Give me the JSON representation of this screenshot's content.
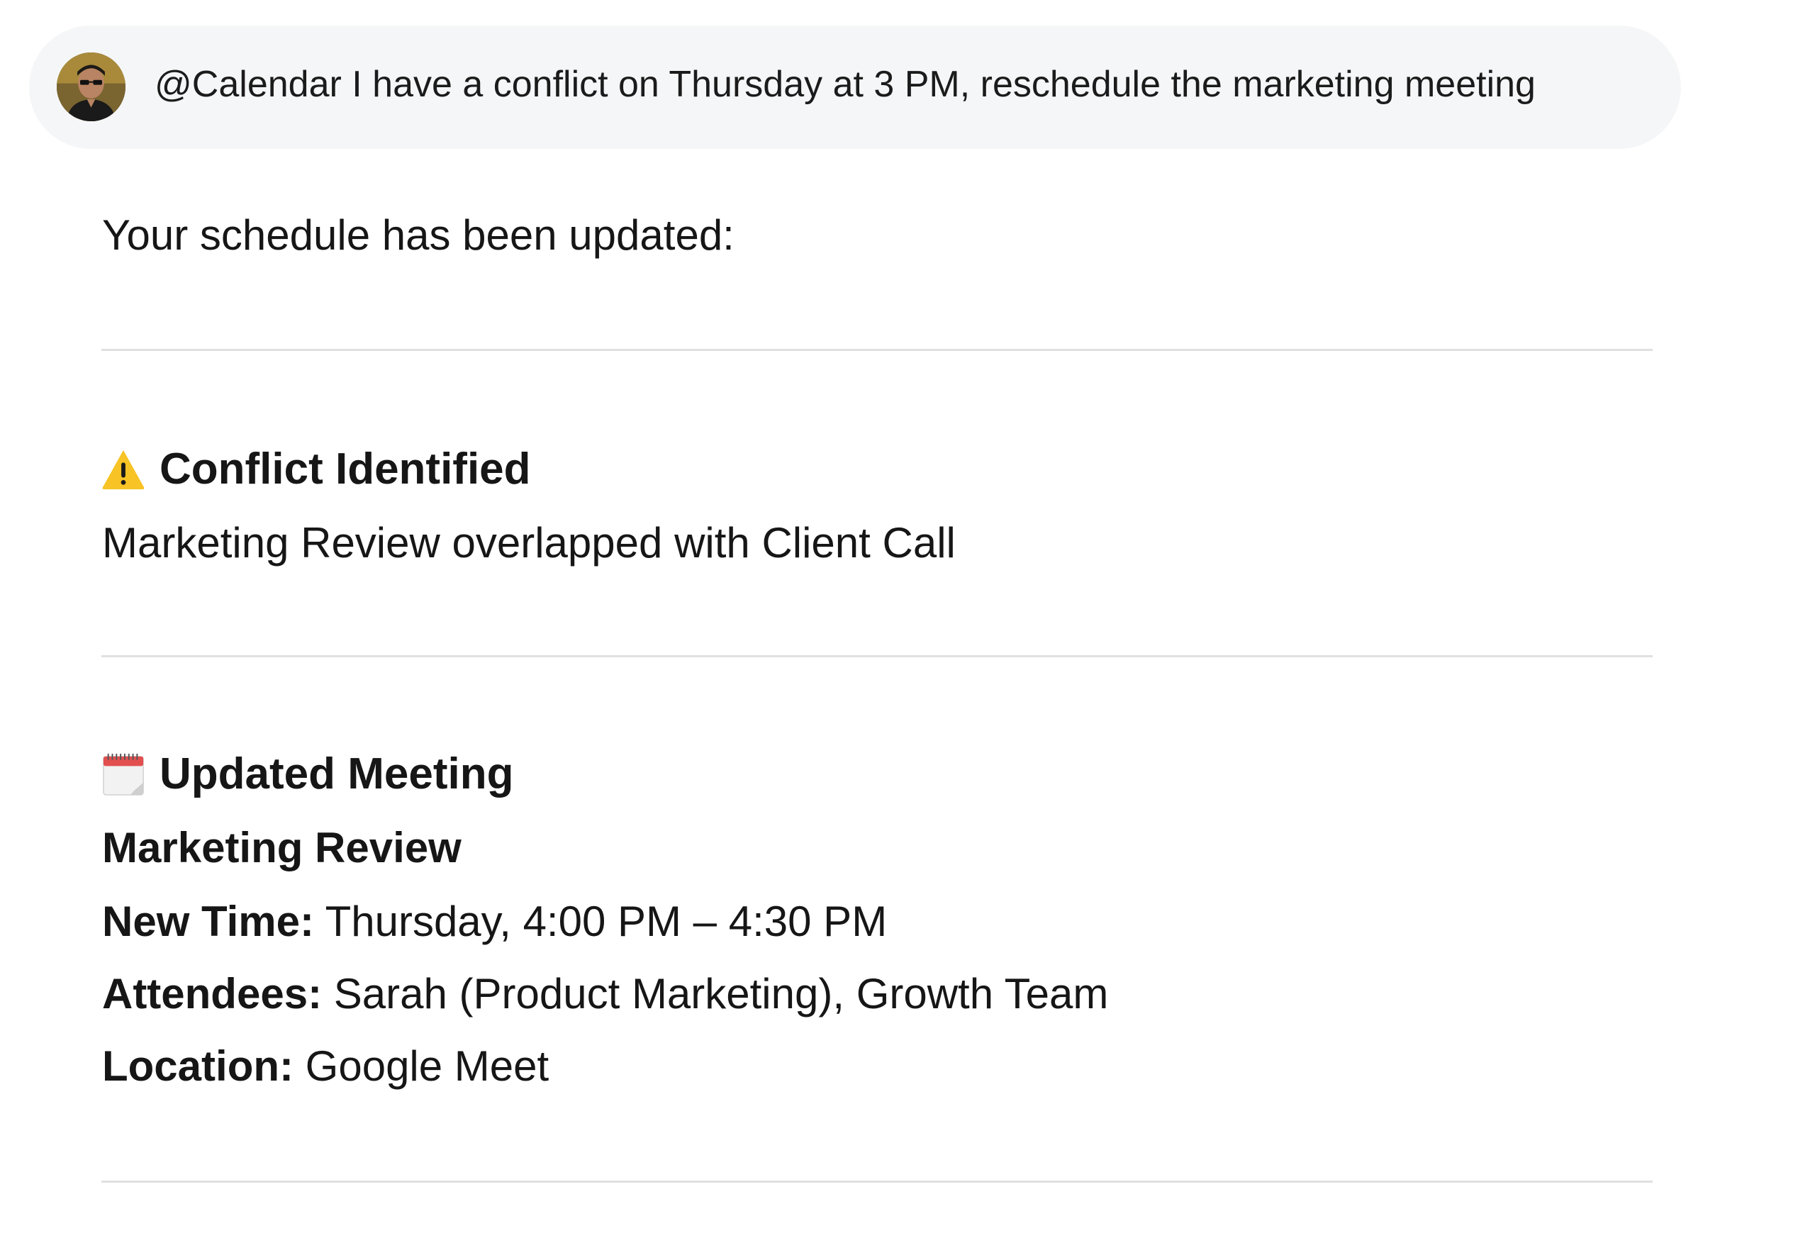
{
  "prompt": {
    "text": "@Calendar I have a conflict on Thursday at 3 PM, reschedule the marketing meeting"
  },
  "response": {
    "intro": "Your schedule has been updated:",
    "conflict": {
      "icon": "warning-icon",
      "title": "Conflict Identified",
      "description": "Marketing Review overlapped with Client Call"
    },
    "updated": {
      "icon": "calendar-icon",
      "title": "Updated Meeting",
      "meeting_name": "Marketing Review",
      "time_label": "New Time:",
      "time_value": " Thursday, 4:00 PM – 4:30 PM",
      "attendees_label": "Attendees:",
      "attendees_value": " Sarah (Product Marketing), Growth Team",
      "location_label": "Location:",
      "location_value": " Google Meet"
    }
  },
  "colors": {
    "bubble_bg": "#f5f6f7",
    "divider": "#e0e0e0",
    "warning": "#f7c325"
  }
}
